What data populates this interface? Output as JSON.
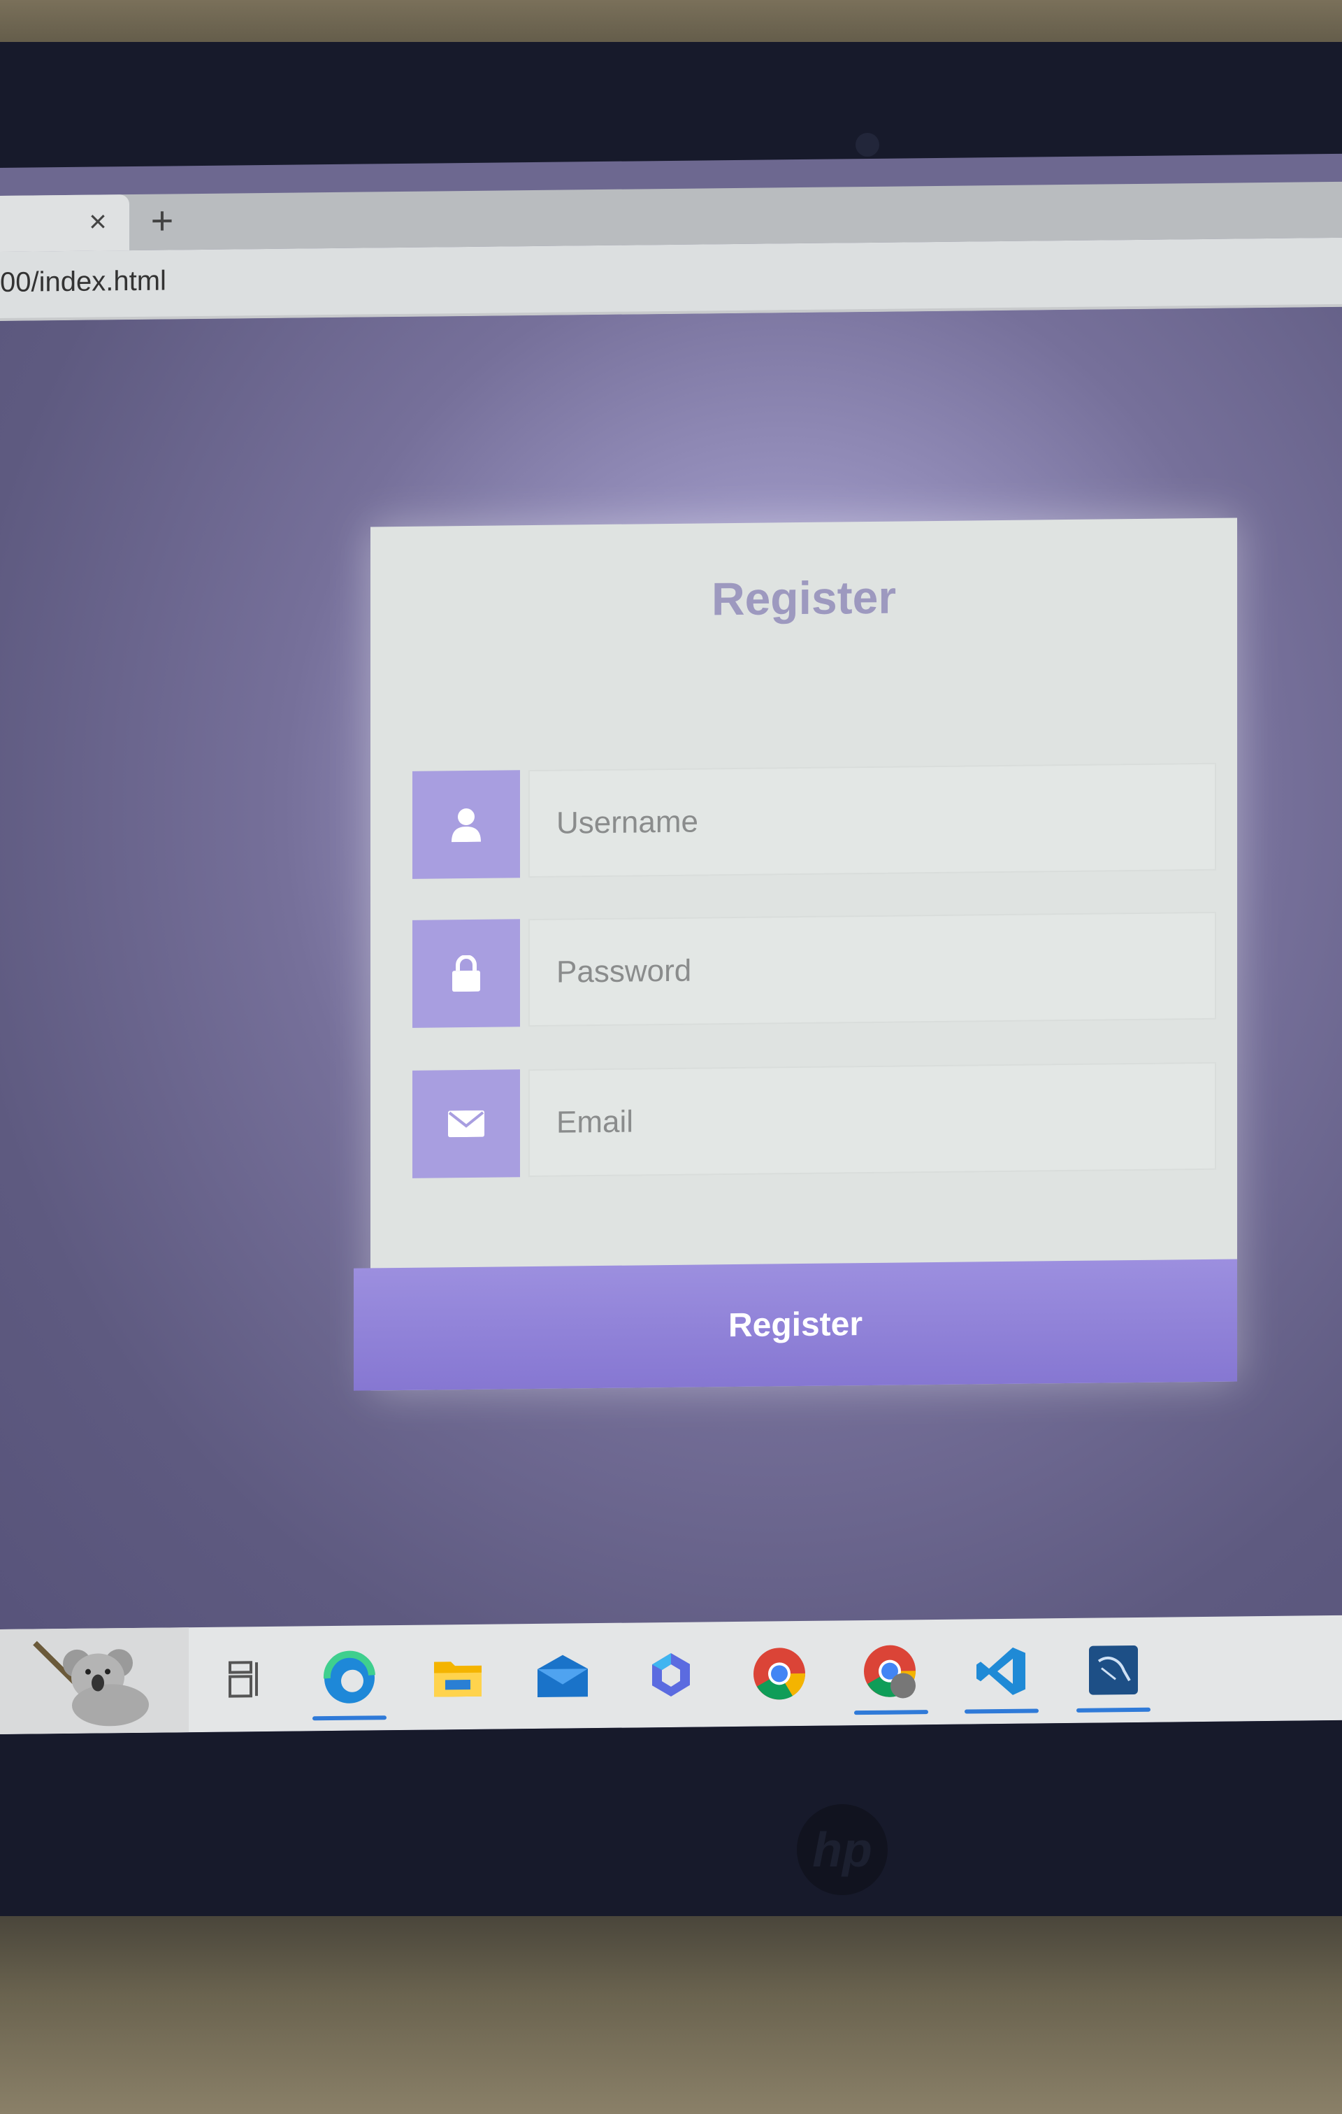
{
  "browser": {
    "tab_close": "×",
    "new_tab": "+",
    "url": "00/index.html"
  },
  "form": {
    "title": "Register",
    "fields": [
      {
        "icon": "user-icon",
        "placeholder": "Username"
      },
      {
        "icon": "lock-icon",
        "placeholder": "Password"
      },
      {
        "icon": "envelope-icon",
        "placeholder": "Email"
      }
    ],
    "submit_label": "Register"
  },
  "taskbar": {
    "apps": [
      {
        "icon": "task-view-icon",
        "active": false
      },
      {
        "icon": "edge-icon",
        "active": true
      },
      {
        "icon": "file-explorer-icon",
        "active": false
      },
      {
        "icon": "mail-icon",
        "active": false
      },
      {
        "icon": "copilot-icon",
        "active": false
      },
      {
        "icon": "chrome-icon",
        "active": false
      },
      {
        "icon": "chrome-profile-icon",
        "active": true
      },
      {
        "icon": "vscode-icon",
        "active": true
      },
      {
        "icon": "mysql-workbench-icon",
        "active": true
      }
    ]
  },
  "colors": {
    "accent": "#a89ee0",
    "button": "#8f82d8",
    "title": "#9d99bf",
    "card_bg": "#dfe3e1"
  },
  "device_brand": "hp"
}
